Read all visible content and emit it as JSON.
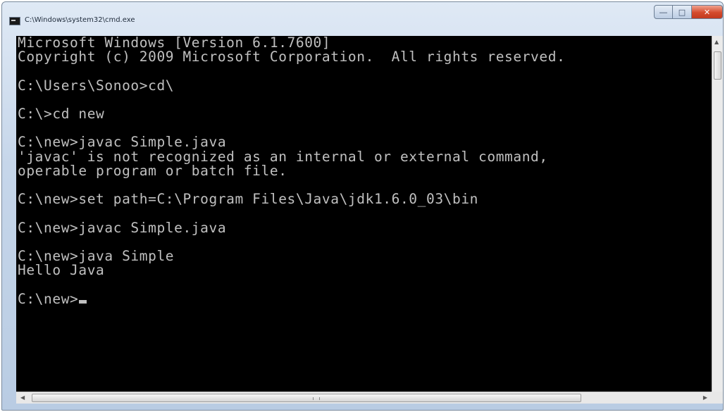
{
  "window": {
    "title": "C:\\Windows\\system32\\cmd.exe",
    "icon": "console-app-icon",
    "controls": {
      "minimize_icon": "minimize-icon",
      "maximize_icon": "maximize-icon",
      "close_icon": "close-icon",
      "close_color": "#c94a2c"
    }
  },
  "console": {
    "background": "#000000",
    "foreground": "#c0c0c0",
    "lines": [
      "Microsoft Windows [Version 6.1.7600]",
      "Copyright (c) 2009 Microsoft Corporation.  All rights reserved.",
      "",
      "C:\\Users\\Sonoo>cd\\",
      "",
      "C:\\>cd new",
      "",
      "C:\\new>javac Simple.java",
      "'javac' is not recognized as an internal or external command,",
      "operable program or batch file.",
      "",
      "C:\\new>set path=C:\\Program Files\\Java\\jdk1.6.0_03\\bin",
      "",
      "C:\\new>javac Simple.java",
      "",
      "C:\\new>java Simple",
      "Hello Java",
      ""
    ],
    "prompt": "C:\\new>"
  }
}
